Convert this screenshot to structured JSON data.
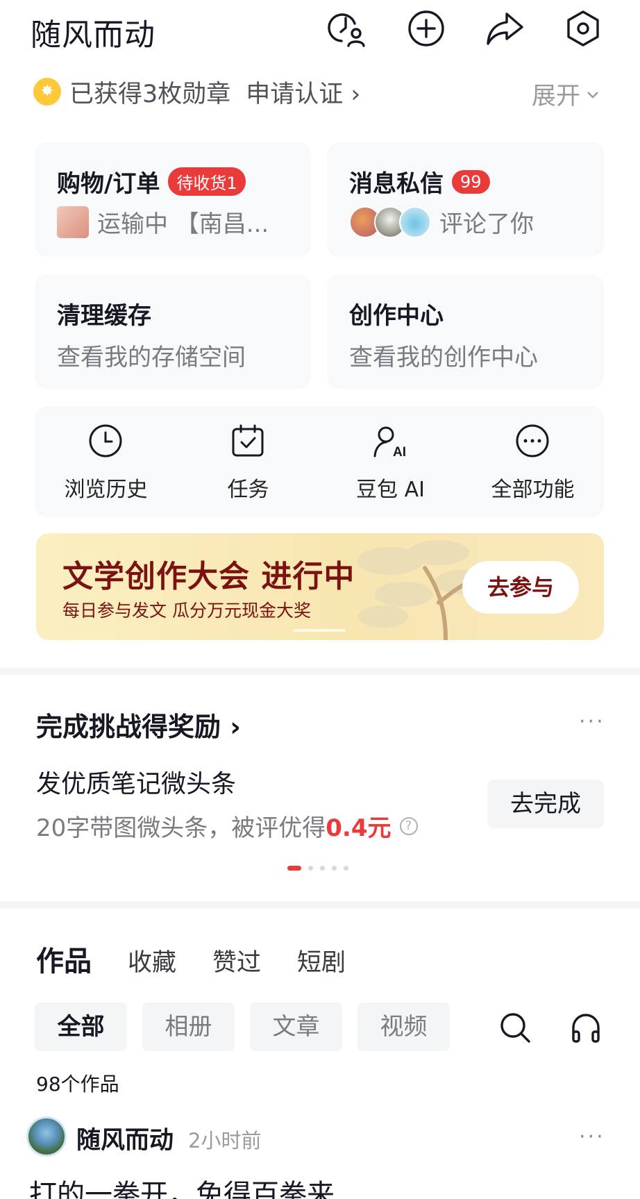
{
  "header": {
    "username": "随风而动",
    "icons": [
      "visitor-icon",
      "add-icon",
      "share-icon",
      "settings-icon"
    ]
  },
  "badges": {
    "text": "已获得3枚勋章",
    "apply": "申请认证 ›",
    "expand": "展开"
  },
  "cards": {
    "orders": {
      "title": "购物/订单",
      "badge": "待收货1",
      "sub": "运输中 【南昌..."
    },
    "messages": {
      "title": "消息私信",
      "badge": "99",
      "sub": "评论了你"
    },
    "cache": {
      "title": "清理缓存",
      "sub": "查看我的存储空间"
    },
    "creator": {
      "title": "创作中心",
      "sub": "查看我的创作中心"
    }
  },
  "tools": [
    {
      "label": "浏览历史",
      "icon": "clock-icon"
    },
    {
      "label": "任务",
      "icon": "calendar-check-icon"
    },
    {
      "label": "豆包 AI",
      "icon": "ai-assistant-icon"
    },
    {
      "label": "全部功能",
      "icon": "more-icon"
    }
  ],
  "banner": {
    "title": "文学创作大会 进行中",
    "sub": "每日参与发文 瓜分万元现金大奖",
    "button": "去参与"
  },
  "challenge": {
    "title": "完成挑战得奖励 ›",
    "more": "···",
    "task_title": "发优质笔记微头条",
    "task_desc": "20字带图微头条，被评优得",
    "task_reward": "0.4元",
    "help": "?",
    "button": "去完成",
    "page_count": 5,
    "active_page": 0
  },
  "tabs": [
    "作品",
    "收藏",
    "赞过",
    "短剧"
  ],
  "filters": [
    "全部",
    "相册",
    "文章",
    "视频"
  ],
  "works_count": "98个作品",
  "post": {
    "author": "随风而动",
    "time": "2小时前",
    "more": "···",
    "text": "打的一拳开，免得百拳来"
  },
  "colors": {
    "accent_red": "#ea3b3b",
    "banner_text": "#7b1111",
    "card_bg": "#f8f9fa"
  }
}
